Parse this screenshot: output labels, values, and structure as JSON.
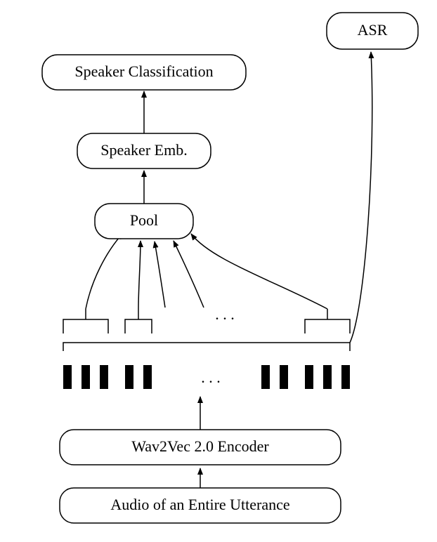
{
  "diagram": {
    "nodes": {
      "input": {
        "label": "Audio of an Entire Utterance"
      },
      "encoder": {
        "label": "Wav2Vec 2.0 Encoder"
      },
      "pool": {
        "label": "Pool"
      },
      "speaker_emb": {
        "label": "Speaker Emb."
      },
      "speaker_cls": {
        "label": "Speaker Classification"
      },
      "asr": {
        "label": "ASR"
      }
    },
    "ellipsis": {
      "tokens": ". . .",
      "groups": ". . ."
    },
    "arrows": [
      {
        "from": "input",
        "to": "encoder"
      },
      {
        "from": "encoder",
        "to": "tokens"
      },
      {
        "from": "tokens",
        "to": "asr"
      },
      {
        "from": "tokens",
        "to": "groups"
      },
      {
        "from": "groups",
        "to": "pool"
      },
      {
        "from": "pool",
        "to": "speaker_emb"
      },
      {
        "from": "speaker_emb",
        "to": "speaker_cls"
      }
    ]
  }
}
